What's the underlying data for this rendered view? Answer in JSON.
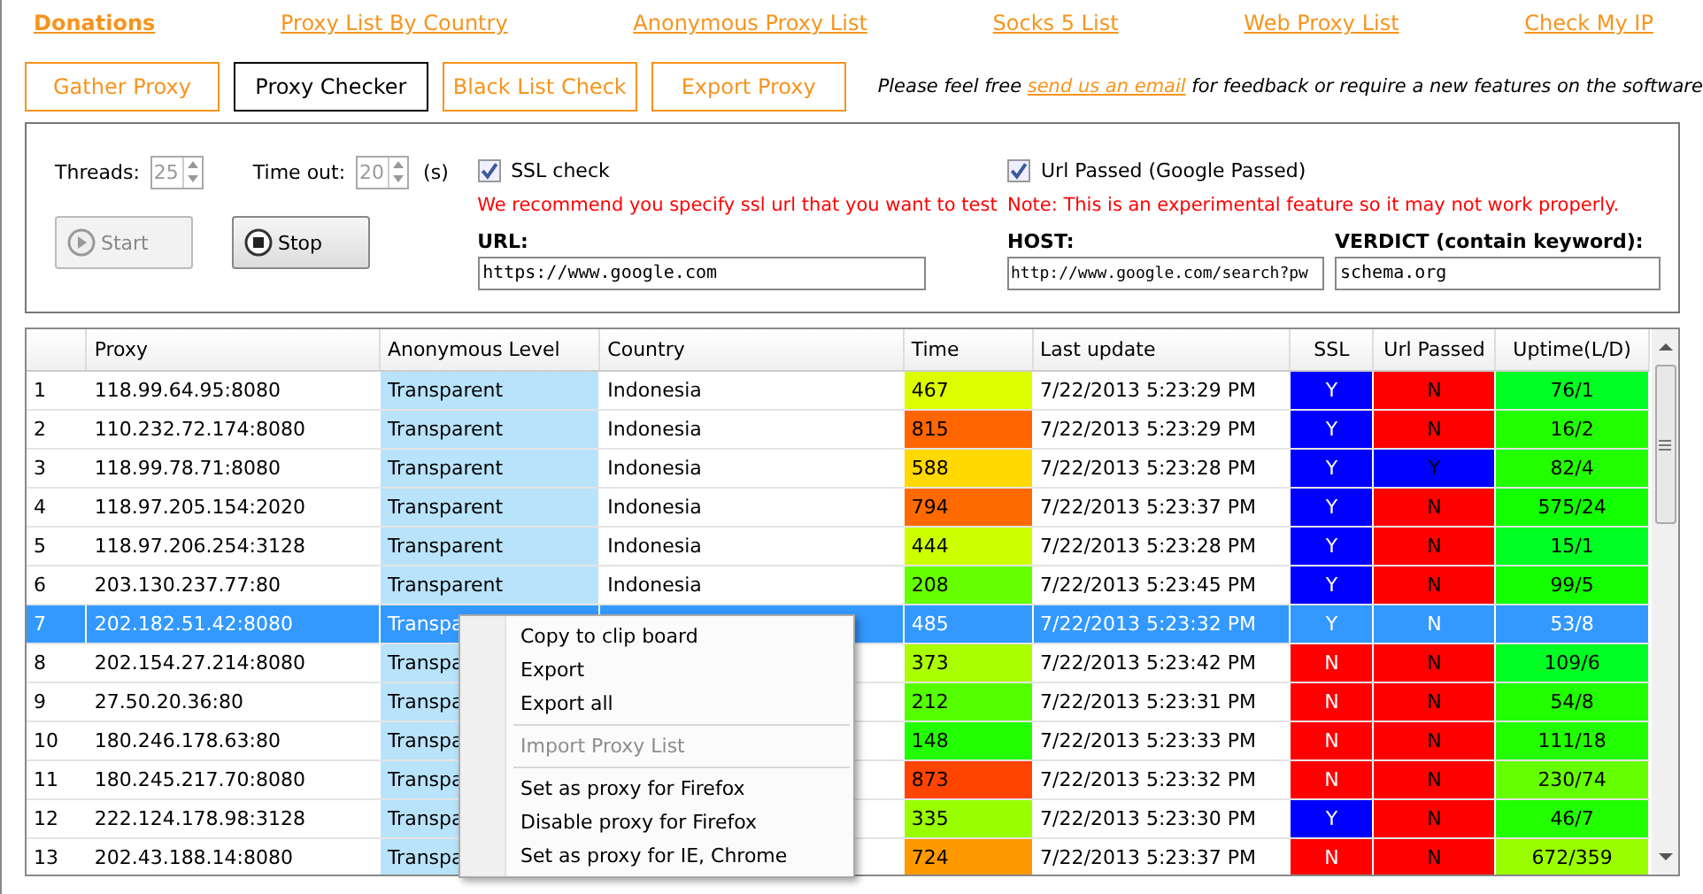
{
  "top_links": [
    {
      "label": "Donations",
      "bold": true
    },
    {
      "label": "Proxy List By Country",
      "bold": false
    },
    {
      "label": "Anonymous Proxy List",
      "bold": false
    },
    {
      "label": "Socks 5 List",
      "bold": false
    },
    {
      "label": "Web Proxy List",
      "bold": false
    },
    {
      "label": "Check My IP",
      "bold": false
    }
  ],
  "tabs": [
    {
      "label": "Gather Proxy",
      "selected": false
    },
    {
      "label": "Proxy Checker",
      "selected": true
    },
    {
      "label": "Black List Check",
      "selected": false
    },
    {
      "label": "Export Proxy",
      "selected": false
    }
  ],
  "feedback": {
    "before": "Please feel free",
    "link": "send us an email",
    "after": "for feedback or require a new features on the software"
  },
  "settings": {
    "threads": {
      "label": "Threads:",
      "value": "25",
      "disabled": true
    },
    "timeout": {
      "label": "Time out:",
      "value": "20",
      "unit": "(s)",
      "disabled": true
    },
    "start_button": {
      "label": "Start",
      "disabled": true
    },
    "stop_button": {
      "label": "Stop",
      "disabled": false
    },
    "ssl_check": {
      "label": "SSL check",
      "checked": true
    },
    "ssl_warning": "We recommend you specify ssl url that you want to test",
    "url": {
      "label": "URL:",
      "value": "https://www.google.com"
    },
    "url_passed": {
      "label": "Url Passed (Google Passed)",
      "checked": true
    },
    "url_note": "Note: This is an experimental feature so it may not work properly.",
    "host": {
      "label": "HOST:",
      "value": "http://www.google.com/search?pw"
    },
    "verdict": {
      "label": "VERDICT (contain keyword):",
      "value": "schema.org"
    }
  },
  "table": {
    "columns": [
      "",
      "Proxy",
      "Anonymous Level",
      "Country",
      "Time",
      "Last update",
      "SSL",
      "Url Passed",
      "Uptime(L/D)"
    ],
    "rows": [
      {
        "number": "1",
        "proxy": "118.99.64.95:8080",
        "level": "Transparent",
        "country": "Indonesia",
        "time": {
          "text": "467",
          "color": "#dcff00"
        },
        "last_update": "7/22/2013 5:23:29 PM",
        "ssl": {
          "text": "Y",
          "color": "#0000ff"
        },
        "url_passed": {
          "text": "N",
          "color": "#ff0000"
        },
        "uptime": {
          "text": "76/1",
          "color": "#00ff22"
        },
        "selected": false
      },
      {
        "number": "2",
        "proxy": "110.232.72.174:8080",
        "level": "Transparent",
        "country": "Indonesia",
        "time": {
          "text": "815",
          "color": "#ff6600"
        },
        "last_update": "7/22/2013 5:23:29 PM",
        "ssl": {
          "text": "Y",
          "color": "#0000ff"
        },
        "url_passed": {
          "text": "N",
          "color": "#ff0000"
        },
        "uptime": {
          "text": "16/2",
          "color": "#22ff00"
        },
        "selected": false
      },
      {
        "number": "3",
        "proxy": "118.99.78.71:8080",
        "level": "Transparent",
        "country": "Indonesia",
        "time": {
          "text": "588",
          "color": "#ffd800"
        },
        "last_update": "7/22/2013 5:23:28 PM",
        "ssl": {
          "text": "Y",
          "color": "#0000ff"
        },
        "url_passed": {
          "text": "Y",
          "color": "#0000ff"
        },
        "uptime": {
          "text": "82/4",
          "color": "#22ff00"
        },
        "selected": false
      },
      {
        "number": "4",
        "proxy": "118.97.205.154:2020",
        "level": "Transparent",
        "country": "Indonesia",
        "time": {
          "text": "794",
          "color": "#ff6a00"
        },
        "last_update": "7/22/2013 5:23:37 PM",
        "ssl": {
          "text": "Y",
          "color": "#0000ff"
        },
        "url_passed": {
          "text": "N",
          "color": "#ff0000"
        },
        "uptime": {
          "text": "575/24",
          "color": "#11ff00"
        },
        "selected": false
      },
      {
        "number": "5",
        "proxy": "118.97.206.254:3128",
        "level": "Transparent",
        "country": "Indonesia",
        "time": {
          "text": "444",
          "color": "#ccff00"
        },
        "last_update": "7/22/2013 5:23:28 PM",
        "ssl": {
          "text": "Y",
          "color": "#0000ff"
        },
        "url_passed": {
          "text": "N",
          "color": "#ff0000"
        },
        "uptime": {
          "text": "15/1",
          "color": "#00ff22"
        },
        "selected": false
      },
      {
        "number": "6",
        "proxy": "203.130.237.77:80",
        "level": "Transparent",
        "country": "Indonesia",
        "time": {
          "text": "208",
          "color": "#66ff00"
        },
        "last_update": "7/22/2013 5:23:45 PM",
        "ssl": {
          "text": "Y",
          "color": "#0000ff"
        },
        "url_passed": {
          "text": "N",
          "color": "#ff0000"
        },
        "uptime": {
          "text": "99/5",
          "color": "#11ff00"
        },
        "selected": false
      },
      {
        "number": "7",
        "proxy": "202.182.51.42:8080",
        "level": "Transpa",
        "country": "",
        "time": {
          "text": "485"
        },
        "last_update": "7/22/2013 5:23:32 PM",
        "ssl": {
          "text": "Y"
        },
        "url_passed": {
          "text": "N"
        },
        "uptime": {
          "text": "53/8"
        },
        "selected": true
      },
      {
        "number": "8",
        "proxy": "202.154.27.214:8080",
        "level": "Transpa",
        "country": "",
        "time": {
          "text": "373",
          "color": "#aaff00"
        },
        "last_update": "7/22/2013 5:23:42 PM",
        "ssl": {
          "text": "N",
          "color": "#ff0000"
        },
        "url_passed": {
          "text": "N",
          "color": "#ff0000"
        },
        "uptime": {
          "text": "109/6",
          "color": "#00ff22"
        },
        "selected": false
      },
      {
        "number": "9",
        "proxy": "27.50.20.36:80",
        "level": "Transpa",
        "country": "",
        "time": {
          "text": "212",
          "color": "#55ff00"
        },
        "last_update": "7/22/2013 5:23:31 PM",
        "ssl": {
          "text": "N",
          "color": "#ff0000"
        },
        "url_passed": {
          "text": "N",
          "color": "#ff0000"
        },
        "uptime": {
          "text": "54/8",
          "color": "#22ff00"
        },
        "selected": false
      },
      {
        "number": "10",
        "proxy": "180.246.178.63:80",
        "level": "Transpa",
        "country": "",
        "time": {
          "text": "148",
          "color": "#22ff00"
        },
        "last_update": "7/22/2013 5:23:33 PM",
        "ssl": {
          "text": "N",
          "color": "#ff0000"
        },
        "url_passed": {
          "text": "N",
          "color": "#ff0000"
        },
        "uptime": {
          "text": "111/18",
          "color": "#22ff00"
        },
        "selected": false
      },
      {
        "number": "11",
        "proxy": "180.245.217.70:8080",
        "level": "Transpa",
        "country": "",
        "time": {
          "text": "873",
          "color": "#ff4400"
        },
        "last_update": "7/22/2013 5:23:32 PM",
        "ssl": {
          "text": "N",
          "color": "#ff0000"
        },
        "url_passed": {
          "text": "N",
          "color": "#ff0000"
        },
        "uptime": {
          "text": "230/74",
          "color": "#66ff00"
        },
        "selected": false
      },
      {
        "number": "12",
        "proxy": "222.124.178.98:3128",
        "level": "Transpa",
        "country": "",
        "time": {
          "text": "335",
          "color": "#99ff00"
        },
        "last_update": "7/22/2013 5:23:30 PM",
        "ssl": {
          "text": "Y",
          "color": "#0000ff"
        },
        "url_passed": {
          "text": "N",
          "color": "#ff0000"
        },
        "uptime": {
          "text": "46/7",
          "color": "#22ff00"
        },
        "selected": false
      },
      {
        "number": "13",
        "proxy": "202.43.188.14:8080",
        "level": "Transpa",
        "country": "",
        "time": {
          "text": "724",
          "color": "#ff9900"
        },
        "last_update": "7/22/2013 5:23:37 PM",
        "ssl": {
          "text": "N",
          "color": "#ff0000"
        },
        "url_passed": {
          "text": "N",
          "color": "#ff0000"
        },
        "uptime": {
          "text": "672/359",
          "color": "#99ff00"
        },
        "selected": false
      }
    ]
  },
  "context_menu": [
    {
      "kind": "item",
      "label": "Copy to clip board",
      "disabled": false
    },
    {
      "kind": "item",
      "label": "Export",
      "disabled": false
    },
    {
      "kind": "item",
      "label": "Export all",
      "disabled": false
    },
    {
      "kind": "separator"
    },
    {
      "kind": "item",
      "label": "Import Proxy List",
      "disabled": true
    },
    {
      "kind": "separator"
    },
    {
      "kind": "item",
      "label": "Set as proxy for Firefox",
      "disabled": false
    },
    {
      "kind": "item",
      "label": "Disable proxy for Firefox",
      "disabled": false
    },
    {
      "kind": "item",
      "label": "Set as proxy for IE, Chrome",
      "disabled": false
    }
  ]
}
